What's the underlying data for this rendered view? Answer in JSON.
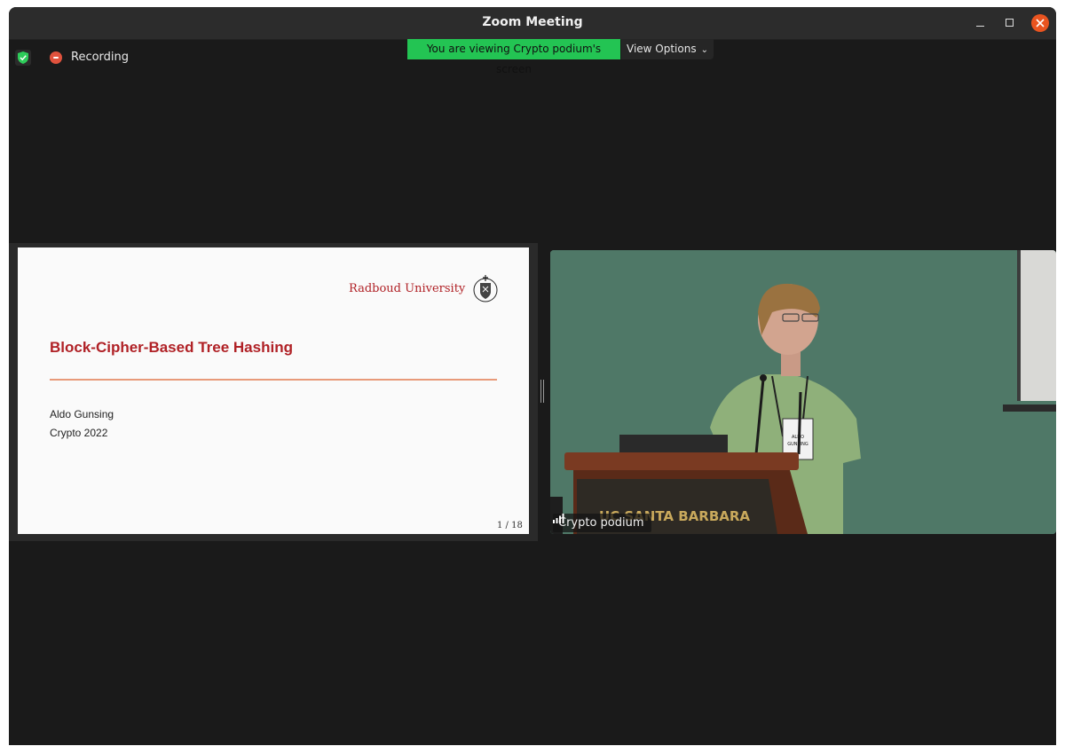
{
  "window": {
    "title": "Zoom Meeting"
  },
  "status": {
    "recording_label": "Recording",
    "banner_text": "You are viewing Crypto podium's screen",
    "view_options_label": "View Options",
    "banner_color": "#23c453"
  },
  "slide": {
    "institution": "Radboud University",
    "title": "Block-Cipher-Based Tree Hashing",
    "author": "Aldo Gunsing",
    "event": "Crypto 2022",
    "page": "1 / 18",
    "accent_color": "#b02126"
  },
  "video": {
    "participant_name": "Crypto podium",
    "podium_sign": "UC SANTA BARBARA",
    "badge_text": "ALDO GUNSING"
  },
  "icons": {
    "security": "shield-check-icon",
    "recording": "record-icon",
    "chevron": "chevron-down-icon",
    "signal": "signal-bars-icon"
  }
}
